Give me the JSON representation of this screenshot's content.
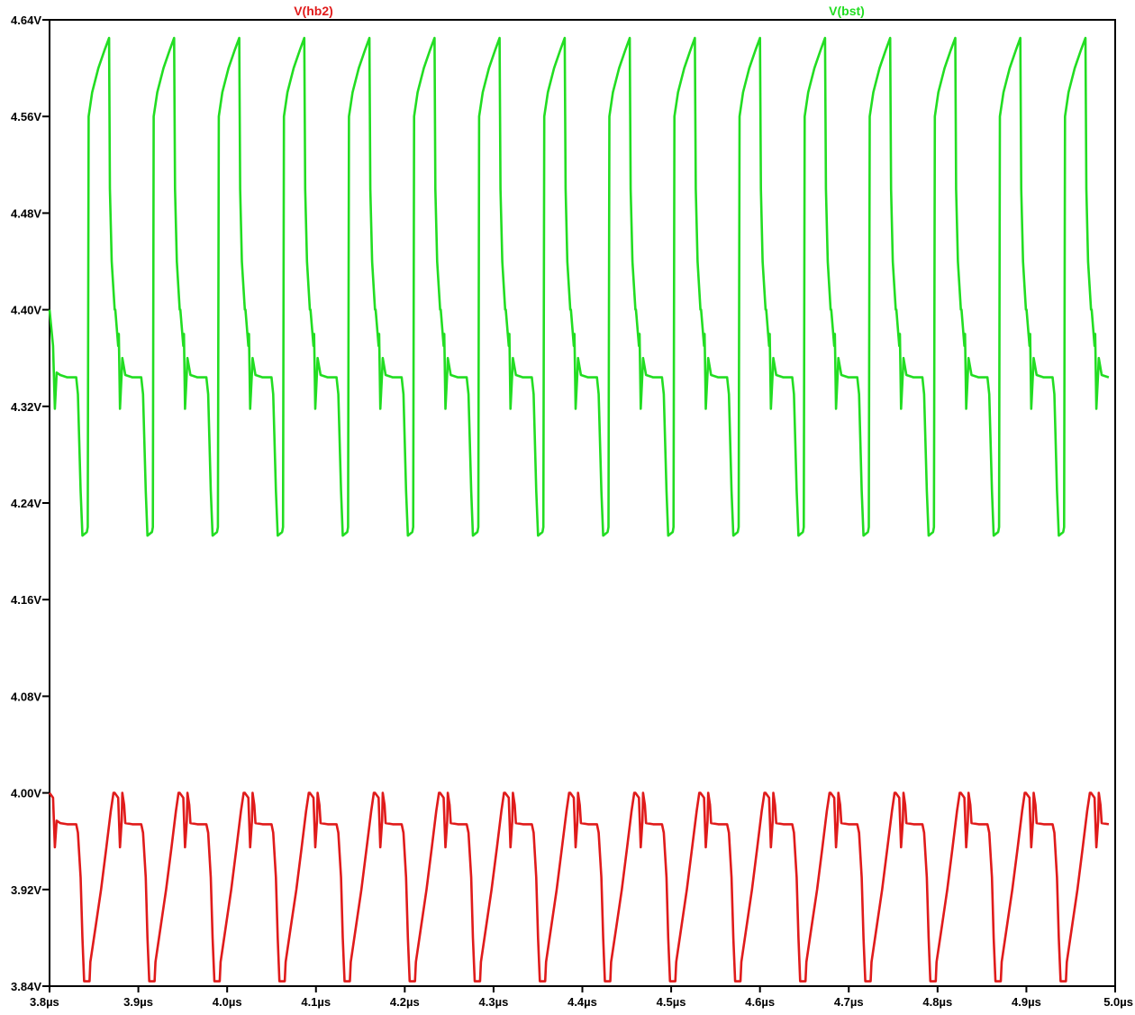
{
  "chart_data": {
    "type": "line",
    "title": "",
    "xlabel": "",
    "ylabel": "",
    "xlim": [
      3.8,
      5.0
    ],
    "ylim": [
      3.84,
      4.64
    ],
    "grid": false,
    "legend_placement": "top",
    "x_ticks": [
      "3.8µs",
      "3.9µs",
      "4.0µs",
      "4.1µs",
      "4.2µs",
      "4.3µs",
      "4.4µs",
      "4.5µs",
      "4.6µs",
      "4.7µs",
      "4.8µs",
      "4.9µs",
      "5.0µs"
    ],
    "y_ticks": [
      "4.64V",
      "4.56V",
      "4.48V",
      "4.40V",
      "4.32V",
      "4.24V",
      "4.16V",
      "4.08V",
      "4.00V",
      "3.92V",
      "3.84V"
    ],
    "period": 0.0733,
    "series": [
      {
        "name": "V(hb2)",
        "color": "#e01b1b",
        "values": [
          [
            3.8,
            4.0
          ],
          [
            3.804,
            3.996
          ],
          [
            3.806,
            3.955
          ],
          [
            3.808,
            3.977
          ],
          [
            3.812,
            3.975
          ],
          [
            3.82,
            3.974
          ],
          [
            3.828,
            3.974
          ],
          [
            3.83,
            3.974
          ],
          [
            3.832,
            3.967
          ],
          [
            3.835,
            3.93
          ],
          [
            3.837,
            3.88
          ],
          [
            3.839,
            3.844
          ],
          [
            3.845,
            3.844
          ],
          [
            3.846,
            3.86
          ],
          [
            3.852,
            3.89
          ],
          [
            3.858,
            3.92
          ],
          [
            3.864,
            3.955
          ],
          [
            3.869,
            3.985
          ],
          [
            3.872,
            4.0
          ],
          [
            3.882,
            4.0
          ],
          [
            3.884,
            3.99
          ]
        ]
      },
      {
        "name": "V(bst)",
        "color": "#22dd22",
        "values": [
          [
            3.8,
            4.4
          ],
          [
            3.804,
            4.37
          ],
          [
            3.806,
            4.318
          ],
          [
            3.808,
            4.348
          ],
          [
            3.812,
            4.346
          ],
          [
            3.82,
            4.344
          ],
          [
            3.828,
            4.344
          ],
          [
            3.83,
            4.344
          ],
          [
            3.832,
            4.33
          ],
          [
            3.835,
            4.25
          ],
          [
            3.837,
            4.213
          ],
          [
            3.842,
            4.216
          ],
          [
            3.843,
            4.22
          ],
          [
            3.844,
            4.56
          ],
          [
            3.848,
            4.58
          ],
          [
            3.855,
            4.6
          ],
          [
            3.862,
            4.615
          ],
          [
            3.867,
            4.625
          ],
          [
            3.868,
            4.5
          ],
          [
            3.87,
            4.44
          ],
          [
            3.874,
            4.4
          ],
          [
            3.878,
            4.38
          ],
          [
            3.882,
            4.36
          ]
        ]
      }
    ]
  }
}
